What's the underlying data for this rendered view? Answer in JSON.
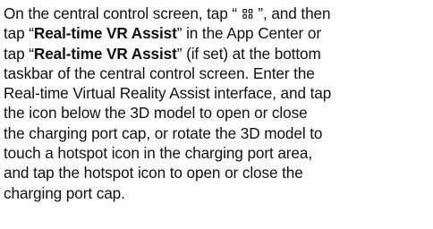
{
  "paragraph": {
    "l1_a": "On the central control screen, tap “ ",
    "icon_name": "app-center-grid-icon",
    "l1_b": " ”, and then",
    "l2_a": "tap “",
    "l2_bold": "Real-time VR Assist",
    "l2_b": "” in the App Center or",
    "l3_a": "tap “",
    "l3_bold": "Real-time VR Assist",
    "l3_b": "” (if set) at the bottom",
    "l4": "taskbar of the central control screen. Enter the",
    "l5": "Real-time Virtual Reality Assist interface, and tap",
    "l6": "the icon below the 3D model to open or close",
    "l7": "the charging port cap, or rotate the 3D model to",
    "l8": "touch a hotspot icon in the charging port area,",
    "l9": "and tap the hotspot icon to open or close the",
    "l10": "charging port cap."
  }
}
